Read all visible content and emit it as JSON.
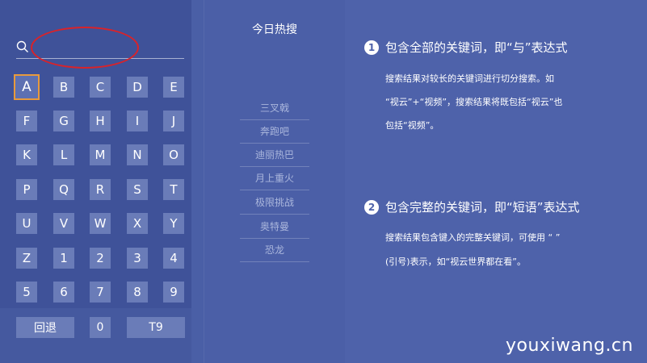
{
  "keyboard": {
    "keys": [
      "A",
      "B",
      "C",
      "D",
      "E",
      "F",
      "G",
      "H",
      "I",
      "J",
      "K",
      "L",
      "M",
      "N",
      "O",
      "P",
      "Q",
      "R",
      "S",
      "T",
      "U",
      "V",
      "W",
      "X",
      "Y",
      "Z",
      "1",
      "2",
      "3",
      "4",
      "5",
      "6",
      "7",
      "8",
      "9"
    ],
    "selected": "A",
    "back_label": "回退",
    "zero_label": "0",
    "t9_label": "T9"
  },
  "search": {
    "value": "",
    "placeholder": ""
  },
  "hot": {
    "title": "今日热搜",
    "items": [
      "三叉戟",
      "奔跑吧",
      "迪丽热巴",
      "月上重火",
      "极限挑战",
      "奥特曼",
      "恐龙"
    ]
  },
  "tips": [
    {
      "num": "1",
      "heading": "包含全部的关键词，即“与”表达式",
      "lines": [
        "搜索结果对较长的关键词进行切分搜索。如",
        "“视云”+“视频”，搜索结果将既包括“视云”也",
        "包括“视频”。"
      ]
    },
    {
      "num": "2",
      "heading": "包含完整的关键词，即“短语”表达式",
      "lines": [
        "搜索结果包含键入的完整关键词，可使用 “ ”",
        "(引号)表示，如“视云世界都在看”。"
      ]
    }
  ],
  "watermark": "youxiwang.cn",
  "colors": {
    "background": "#4a5fa6",
    "key": "#6a7cb8",
    "selected_border": "#e89a3c",
    "annotation": "#d8232a"
  }
}
